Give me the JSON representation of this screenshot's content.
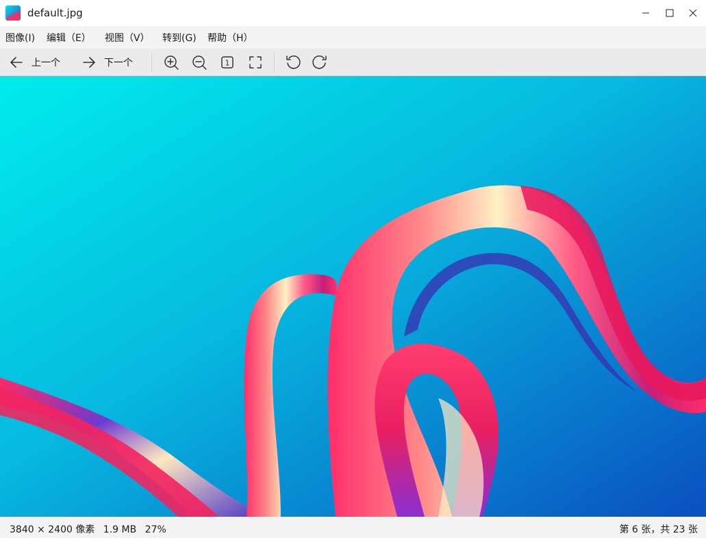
{
  "window": {
    "title": "default.jpg",
    "app_icon": "image-viewer-icon",
    "controls": [
      "minimize-icon",
      "maximize-icon",
      "close-icon"
    ]
  },
  "menu": {
    "items": [
      "图像(I)",
      "编辑（E）",
      "视图（V）",
      "转到(G)",
      "帮助（H）"
    ]
  },
  "toolbar": {
    "prev_label": "上一个",
    "next_label": "下一个",
    "icons": [
      "arrow-left-icon",
      "arrow-right-icon",
      "zoom-in-icon",
      "zoom-out-icon",
      "actual-size-icon",
      "fit-to-window-icon",
      "rotate-left-icon",
      "rotate-right-icon"
    ],
    "actual_size_glyph": "1"
  },
  "image": {
    "description_colors": {
      "background_from": "#00e8ea",
      "background_to": "#0a5bc4",
      "ribbon_pink": "#f0245e",
      "ribbon_cream": "#fff2c8",
      "ribbon_purple": "#5a2bbf"
    }
  },
  "status": {
    "dimensions": "3840 × 2400 像素",
    "file_size": "1.9 MB",
    "zoom": "27%",
    "position": "第 6 张，共 23 张"
  }
}
